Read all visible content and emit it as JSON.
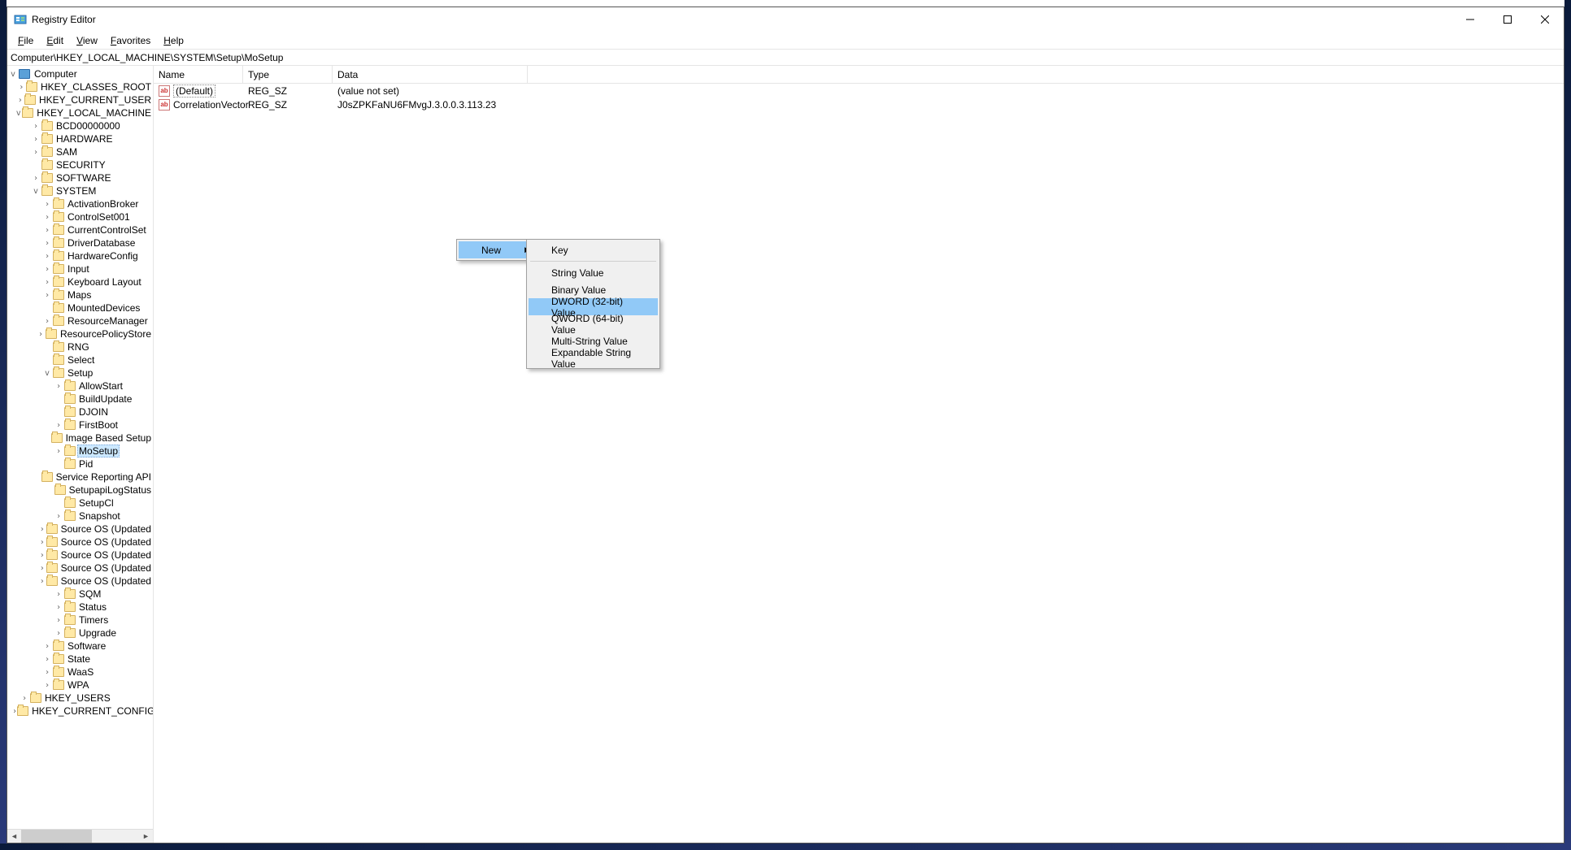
{
  "window": {
    "title": "Registry Editor"
  },
  "menu": {
    "file": "File",
    "edit": "Edit",
    "view": "View",
    "favorites": "Favorites",
    "help": "Help"
  },
  "address": "Computer\\HKEY_LOCAL_MACHINE\\SYSTEM\\Setup\\MoSetup",
  "tree": {
    "computer": "Computer",
    "hkcr": "HKEY_CLASSES_ROOT",
    "hkcu": "HKEY_CURRENT_USER",
    "hklm": "HKEY_LOCAL_MACHINE",
    "bcd": "BCD00000000",
    "hardware": "HARDWARE",
    "sam": "SAM",
    "security": "SECURITY",
    "software": "SOFTWARE",
    "system": "SYSTEM",
    "activationbroker": "ActivationBroker",
    "controlset001": "ControlSet001",
    "currentcontrolset": "CurrentControlSet",
    "driverdatabase": "DriverDatabase",
    "hardwareconfig": "HardwareConfig",
    "input": "Input",
    "keyboardlayout": "Keyboard Layout",
    "maps": "Maps",
    "mounteddevices": "MountedDevices",
    "resourcemanager": "ResourceManager",
    "resourcepolicystore": "ResourcePolicyStore",
    "rng": "RNG",
    "select": "Select",
    "setup": "Setup",
    "allowstart": "AllowStart",
    "buildupdate": "BuildUpdate",
    "djoin": "DJOIN",
    "firstboot": "FirstBoot",
    "imagebasedsetup": "Image Based Setup",
    "mosetup": "MoSetup",
    "pid": "Pid",
    "servicereporting": "Service Reporting API",
    "setupapilogstatus": "SetupapiLogStatus",
    "setupcl": "SetupCl",
    "snapshot": "Snapshot",
    "sourceos1": "Source OS (Updated",
    "sourceos2": "Source OS (Updated",
    "sourceos3": "Source OS (Updated",
    "sourceos4": "Source OS (Updated",
    "sourceos5": "Source OS (Updated",
    "sqm": "SQM",
    "status": "Status",
    "timers": "Timers",
    "upgrade": "Upgrade",
    "software2": "Software",
    "state": "State",
    "waas": "WaaS",
    "wpa": "WPA",
    "hku": "HKEY_USERS",
    "hkcc": "HKEY_CURRENT_CONFIG"
  },
  "columns": {
    "name": "Name",
    "type": "Type",
    "data": "Data"
  },
  "values": [
    {
      "name": "(Default)",
      "type": "REG_SZ",
      "data": "(value not set)"
    },
    {
      "name": "CorrelationVector",
      "type": "REG_SZ",
      "data": "J0sZPKFaNU6FMvgJ.3.0.0.3.113.23"
    }
  ],
  "context_menu": {
    "new": "New",
    "submenu": {
      "key": "Key",
      "string": "String Value",
      "binary": "Binary Value",
      "dword": "DWORD (32-bit) Value",
      "qword": "QWORD (64-bit) Value",
      "multistring": "Multi-String Value",
      "expandable": "Expandable String Value"
    }
  }
}
